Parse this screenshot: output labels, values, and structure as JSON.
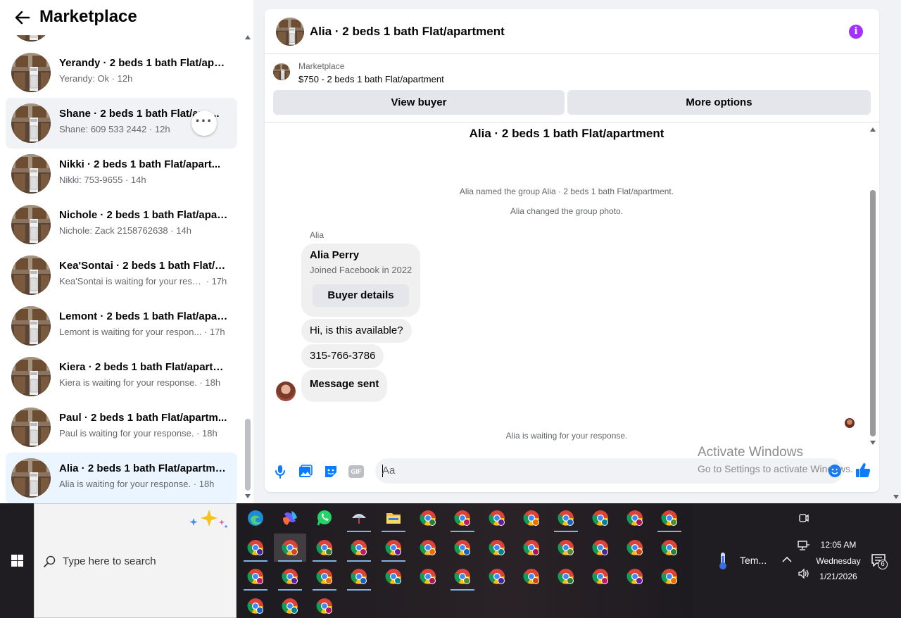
{
  "left": {
    "title": "Marketplace",
    "conversations": [
      {
        "name": "Yerandy · 2 beds 1 bath Flat/apa...",
        "snippet": "Yerandy: Ok",
        "time": "12h",
        "state": "normal"
      },
      {
        "name": "Shane · 2 beds 1 bath Flat/apa...",
        "snippet": "Shane: 609 533 2442",
        "time": "12h",
        "state": "hover"
      },
      {
        "name": "Nikki · 2 beds 1 bath Flat/apart...",
        "snippet": "Nikki: 753-9655",
        "time": "14h",
        "state": "normal"
      },
      {
        "name": "Nichole · 2 beds 1 bath Flat/apar...",
        "snippet": "Nichole: Zack 2158762638",
        "time": "14h",
        "state": "normal"
      },
      {
        "name": "Kea'Sontai · 2 beds 1 bath Flat/a...",
        "snippet": "Kea'Sontai is waiting for your resp...",
        "time": "17h",
        "state": "normal"
      },
      {
        "name": "Lemont · 2 beds 1 bath Flat/apar...",
        "snippet": "Lemont is waiting for your respon...",
        "time": "17h",
        "state": "normal"
      },
      {
        "name": "Kiera · 2 beds 1 bath Flat/apartm...",
        "snippet": "Kiera is waiting for your response.",
        "time": "18h",
        "state": "normal"
      },
      {
        "name": "Paul · 2 beds 1 bath Flat/apartm...",
        "snippet": "Paul is waiting for your response.",
        "time": "18h",
        "state": "normal"
      },
      {
        "name": "Alia · 2 beds 1 bath Flat/apartme...",
        "snippet": "Alia is waiting for your response.",
        "time": "18h",
        "state": "active"
      }
    ],
    "more_label": "···",
    "sep": " · "
  },
  "chat": {
    "title": "Alia · 2 beds 1 bath Flat/apartment",
    "info_label": "i",
    "marketplace_label": "Marketplace",
    "listing": "$750 - 2 beds 1 bath Flat/apartment",
    "view_buyer": "View buyer",
    "more_options": "More options",
    "group_title": "Alia · 2 beds 1 bath Flat/apartment",
    "system1": "Alia named the group Alia · 2 beds 1 bath Flat/apartment.",
    "system2": "Alia changed the group photo.",
    "sender": "Alia",
    "card": {
      "name": "Alia Perry",
      "joined": "Joined Facebook in 2022",
      "button": "Buyer details"
    },
    "messages": [
      "Hi, is this available?",
      "315-766-3786",
      "Message sent"
    ],
    "waiting": "Alia is waiting for your response.",
    "input_placeholder": "Aa",
    "composer_icons": [
      "microphone-icon",
      "photo-icon",
      "sticker-icon",
      "gif-icon"
    ],
    "gif_label": "GIF"
  },
  "watermark": {
    "line1": "Activate Windows",
    "line2": "Go to Settings to activate Windows."
  },
  "taskbar": {
    "search_placeholder": "Type here to search",
    "weather": "Tem...",
    "time": "12:05 AM",
    "day": "Wednesday",
    "date": "1/21/2026",
    "notifications": "6"
  },
  "colors": {
    "accent": "#0a7cff",
    "info": "#a033ff",
    "active_row": "#ebf5ff"
  }
}
